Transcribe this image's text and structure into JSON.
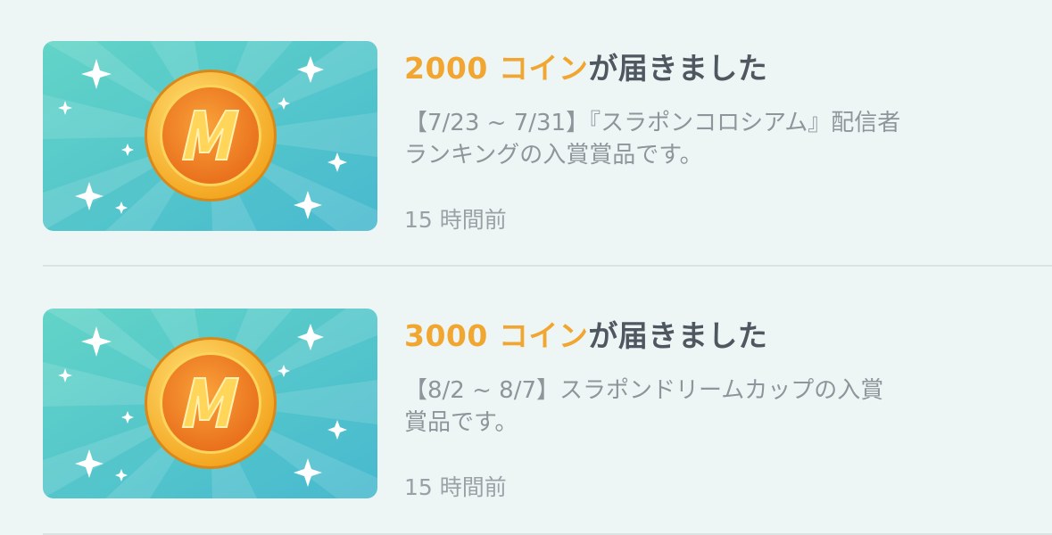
{
  "notifications": [
    {
      "title_amount": "2000 コイン",
      "title_suffix": "が届きました",
      "description": "【7/23 ~ 7/31】『スラポンコロシアム』配信者ランキングの入賞賞品です。",
      "time": "15 時間前",
      "icon": "coin-icon"
    },
    {
      "title_amount": "3000 コイン",
      "title_suffix": "が届きました",
      "description": "【8/2 ~ 8/7】スラポンドリームカップの入賞賞品です。",
      "time": "15 時間前",
      "icon": "coin-icon"
    }
  ],
  "colors": {
    "background": "#eef6f5",
    "accent": "#f0a630",
    "title": "#4f5760",
    "muted": "#8e959b",
    "thumb_teal": "#4cc8c4"
  }
}
